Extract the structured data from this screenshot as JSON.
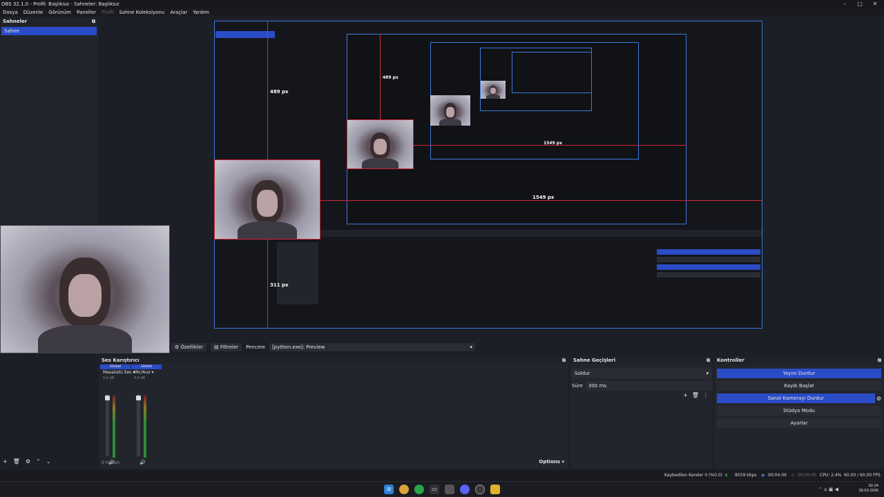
{
  "window": {
    "title": "OBS 32.1.0 - Profil: Başlıksız - Sahneler: Başlıksız",
    "controls": [
      "–",
      "□",
      "✕"
    ]
  },
  "menu": {
    "items": [
      "Dosya",
      "Düzenle",
      "Görünüm",
      "Paneller",
      "Profil",
      "Sahne Koleksiyonu",
      "Araçlar",
      "Yardım"
    ]
  },
  "scenes": {
    "title": "Sahneler",
    "items": [
      "Sahne"
    ]
  },
  "preview": {
    "measure_top": "489 px",
    "measure_right": "1549 px",
    "measure_bottom": "311 px",
    "inner_measure_top": "489 px",
    "inner_measure_right": "1549 px"
  },
  "source_toolbar": {
    "properties": "Özellikler",
    "filters": "Filtreler",
    "window_label": "Pencere",
    "window_value": "[python.exe]: Preview"
  },
  "mixer": {
    "title": "Ses Karıştırıcı",
    "channels": [
      {
        "tag": "Global",
        "name": "Masaüstü Ses",
        "db": "0.0 dB"
      },
      {
        "tag": "Global",
        "name": "Mic/Aux",
        "db": "0.0 dB"
      }
    ],
    "hidden": "0 hidden",
    "options": "Options"
  },
  "transitions": {
    "title": "Sahne Geçişleri",
    "type": "Soldur",
    "duration_label": "Süre",
    "duration_value": "300 ms"
  },
  "controls": {
    "title": "Kontroller",
    "buttons": [
      "Yayını Durdur",
      "Kaydı Başlat",
      "Sanal Kamerayı Durdur",
      "Stüdyo Modu",
      "Ayarlar"
    ]
  },
  "status": {
    "dropped": "Kaybedilen Kareler 0 (%0.0)",
    "bitrate": "8559 kbps",
    "stream_time": "00:04:09",
    "rec_time": "00:00:00",
    "cpu": "CPU: 2.4%",
    "fps": "60.00 / 60.00 FPS"
  },
  "clock": {
    "time": "02:24",
    "date": "28.03.2026"
  },
  "colors": {
    "accent": "#2b4cc7",
    "selection": "#3a7be0",
    "measure": "#d4263a",
    "bg": "#1d1f26"
  }
}
